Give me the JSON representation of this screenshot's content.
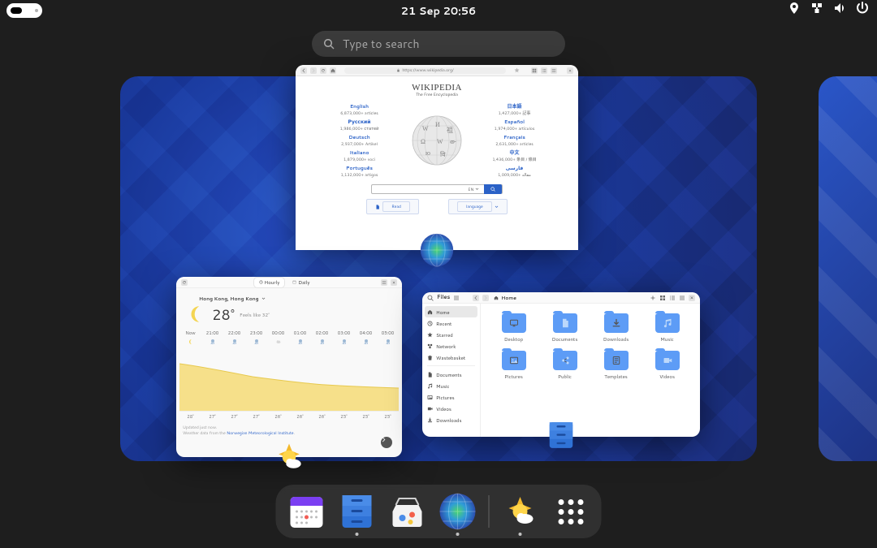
{
  "topbar": {
    "datetime": "21 Sep  20:56"
  },
  "search": {
    "placeholder": "Type to search"
  },
  "browser": {
    "url": "https://www.wikipedia.org/",
    "wiki_title": "WIKIPEDIA",
    "wiki_subtitle": "The Free Encyclopedia",
    "langs_left": [
      {
        "name": "English",
        "count": "6,873,000+ articles"
      },
      {
        "name": "Русский",
        "count": "1,986,000+ статей"
      },
      {
        "name": "Deutsch",
        "count": "2,937,000+ Artikel"
      },
      {
        "name": "Italiano",
        "count": "1,879,000+ voci"
      },
      {
        "name": "Português",
        "count": "1,132,000+ artigos"
      }
    ],
    "langs_right": [
      {
        "name": "日本語",
        "count": "1,427,000+ 記事"
      },
      {
        "name": "Español",
        "count": "1,974,000+ artículos"
      },
      {
        "name": "Français",
        "count": "2,631,000+ articles"
      },
      {
        "name": "中文",
        "count": "1,436,000+ 条目 / 條目"
      },
      {
        "name": "فارسی",
        "count": "1,009,000+ مقاله"
      }
    ],
    "search_lang": "EN",
    "read_label": "Read",
    "lang_label": "language"
  },
  "weather": {
    "tabs": {
      "hourly": "Hourly",
      "daily": "Daily"
    },
    "location": "Hong Kong, Hong Kong",
    "temp": "28°",
    "feels": "Feels like 32°",
    "hours": [
      "Now",
      "21:00",
      "22:00",
      "23:00",
      "00:00",
      "01:00",
      "02:00",
      "03:00",
      "04:00",
      "05:00"
    ],
    "temps": [
      "28°",
      "27°",
      "27°",
      "27°",
      "26°",
      "26°",
      "26°",
      "25°",
      "25°",
      "25°"
    ],
    "updated": "Updated just now.",
    "credit_pre": "Weather data from the ",
    "credit_link": "Norwegian Meteorological Institute"
  },
  "files": {
    "app": "Files",
    "crumb": "Home",
    "sidebar": [
      {
        "key": "home",
        "label": "Home",
        "icon": "home",
        "selected": true
      },
      {
        "key": "recent",
        "label": "Recent",
        "icon": "clock"
      },
      {
        "key": "starred",
        "label": "Starred",
        "icon": "star"
      },
      {
        "key": "network",
        "label": "Network",
        "icon": "network"
      },
      {
        "key": "trash",
        "label": "Wastebasket",
        "icon": "trash"
      }
    ],
    "sidebar_lower": [
      {
        "key": "documents",
        "label": "Documents",
        "icon": "file"
      },
      {
        "key": "music",
        "label": "Music",
        "icon": "music"
      },
      {
        "key": "pictures",
        "label": "Pictures",
        "icon": "image"
      },
      {
        "key": "videos",
        "label": "Videos",
        "icon": "video"
      },
      {
        "key": "downloads",
        "label": "Downloads",
        "icon": "download"
      }
    ],
    "grid": [
      {
        "label": "Desktop",
        "icon": "monitor"
      },
      {
        "label": "Documents",
        "icon": "file"
      },
      {
        "label": "Downloads",
        "icon": "download"
      },
      {
        "label": "Music",
        "icon": "music"
      },
      {
        "label": "Pictures",
        "icon": "image"
      },
      {
        "label": "Public",
        "icon": "share"
      },
      {
        "label": "Templates",
        "icon": "template"
      },
      {
        "label": "Videos",
        "icon": "video"
      }
    ]
  },
  "dock": {
    "items": [
      {
        "name": "calendar",
        "running": false
      },
      {
        "name": "files",
        "running": true
      },
      {
        "name": "software",
        "running": false
      },
      {
        "name": "web",
        "running": true
      },
      {
        "name": "weather",
        "running": true
      },
      {
        "name": "appgrid",
        "running": false
      }
    ]
  }
}
